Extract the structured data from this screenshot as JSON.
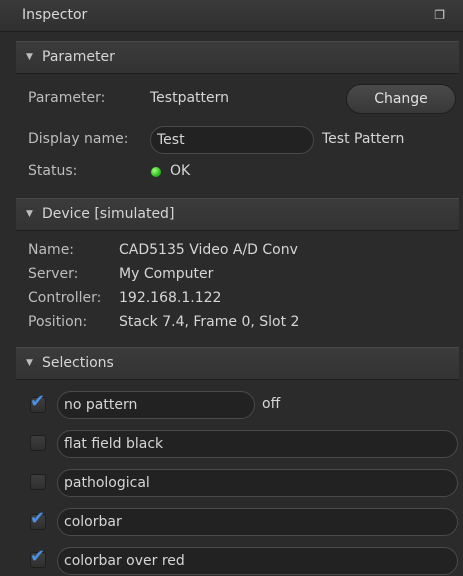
{
  "window": {
    "title": "Inspector",
    "float_icon": "float-window-icon"
  },
  "parameter_section": {
    "header": "Parameter",
    "parameter_label": "Parameter:",
    "parameter_value": "Testpattern",
    "change_button": "Change",
    "display_name_label": "Display name:",
    "display_name_value": "Test",
    "display_name_extra": "Test Pattern",
    "status_label": "Status:",
    "status_value": "OK",
    "status_color": "#2fbf1f"
  },
  "device_section": {
    "header": "Device [simulated]",
    "rows": [
      {
        "label": "Name:",
        "value": "CAD5135 Video A/D Conv"
      },
      {
        "label": "Server:",
        "value": "My Computer"
      },
      {
        "label": "Controller:",
        "value": "192.168.1.122"
      },
      {
        "label": "Position:",
        "value": "Stack 7.4, Frame 0, Slot 2"
      }
    ]
  },
  "selections_section": {
    "header": "Selections",
    "items": [
      {
        "label": "no pattern",
        "checked": true,
        "extra": "off"
      },
      {
        "label": "flat field black",
        "checked": false,
        "extra": ""
      },
      {
        "label": "pathological",
        "checked": false,
        "extra": ""
      },
      {
        "label": "colorbar",
        "checked": true,
        "extra": ""
      },
      {
        "label": "colorbar over red",
        "checked": true,
        "extra": ""
      }
    ]
  },
  "colors": {
    "panel_bg": "#2b2b2b",
    "check_accent": "#4a8fe0"
  }
}
